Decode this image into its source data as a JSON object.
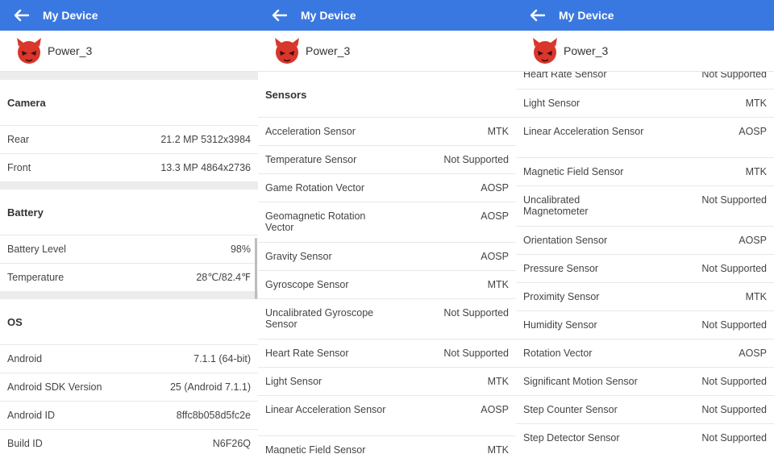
{
  "app": {
    "title": "My Device",
    "device_name": "Power_3"
  },
  "screens": [
    {
      "offset": 0,
      "blocks": [
        {
          "type": "gap"
        },
        {
          "type": "section",
          "title": "Camera"
        },
        {
          "type": "row",
          "label": "Rear",
          "value": "21.2 MP 5312x3984"
        },
        {
          "type": "row",
          "label": "Front",
          "value": "13.3 MP 4864x2736"
        },
        {
          "type": "gap"
        },
        {
          "type": "section",
          "title": "Battery"
        },
        {
          "type": "row",
          "label": "Battery Level",
          "value": "98%"
        },
        {
          "type": "row",
          "label": "Temperature",
          "value": "28℃/82.4℉"
        },
        {
          "type": "gap"
        },
        {
          "type": "section",
          "title": "OS"
        },
        {
          "type": "row",
          "label": "Android",
          "value": "7.1.1 (64-bit)"
        },
        {
          "type": "row",
          "label": "Android SDK Version",
          "value": "25 (Android 7.1.1)"
        },
        {
          "type": "row",
          "label": "Android ID",
          "value": "8ffc8b058d5fc2e"
        },
        {
          "type": "row",
          "label": "Build ID",
          "value": "N6F26Q"
        }
      ]
    },
    {
      "offset": 0,
      "blocks": [
        {
          "type": "section",
          "title": "Sensors"
        },
        {
          "type": "row",
          "label": "Acceleration Sensor",
          "value": "MTK"
        },
        {
          "type": "row",
          "label": "Temperature Sensor",
          "value": "Not Supported"
        },
        {
          "type": "row",
          "label": "Game Rotation Vector",
          "value": "AOSP"
        },
        {
          "type": "row",
          "label": "Geomagnetic Rotation Vector",
          "value": "AOSP",
          "double": true
        },
        {
          "type": "row",
          "label": "Gravity Sensor",
          "value": "AOSP"
        },
        {
          "type": "row",
          "label": "Gyroscope Sensor",
          "value": "MTK"
        },
        {
          "type": "row",
          "label": "Uncalibrated Gyroscope Sensor",
          "value": "Not Supported",
          "double": true
        },
        {
          "type": "row",
          "label": "Heart Rate Sensor",
          "value": "Not Supported"
        },
        {
          "type": "row",
          "label": "Light Sensor",
          "value": "MTK"
        },
        {
          "type": "row",
          "label": "Linear Acceleration Sensor",
          "value": "AOSP",
          "double": true
        },
        {
          "type": "row",
          "label": "Magnetic Field Sensor",
          "value": "MTK"
        }
      ]
    },
    {
      "offset": -14,
      "blocks": [
        {
          "type": "row",
          "label": "Heart Rate Sensor",
          "value": "Not Supported",
          "first": true
        },
        {
          "type": "row",
          "label": "Light Sensor",
          "value": "MTK"
        },
        {
          "type": "row",
          "label": "Linear Acceleration Sensor",
          "value": "AOSP",
          "double": true
        },
        {
          "type": "row",
          "label": "Magnetic Field Sensor",
          "value": "MTK"
        },
        {
          "type": "row",
          "label": "Uncalibrated Magnetometer",
          "value": "Not Supported",
          "double": true
        },
        {
          "type": "row",
          "label": "Orientation Sensor",
          "value": "AOSP"
        },
        {
          "type": "row",
          "label": "Pressure Sensor",
          "value": "Not Supported"
        },
        {
          "type": "row",
          "label": "Proximity Sensor",
          "value": "MTK"
        },
        {
          "type": "row",
          "label": "Humidity Sensor",
          "value": "Not Supported"
        },
        {
          "type": "row",
          "label": "Rotation Vector",
          "value": "AOSP"
        },
        {
          "type": "row",
          "label": "Significant Motion Sensor",
          "value": "Not Supported"
        },
        {
          "type": "row",
          "label": "Step Counter Sensor",
          "value": "Not Supported"
        },
        {
          "type": "row",
          "label": "Step Detector Sensor",
          "value": "Not Supported"
        }
      ]
    }
  ],
  "colors": {
    "appbar": "#3a78e1",
    "logo": "#d9362c",
    "gap": "#ececec"
  }
}
